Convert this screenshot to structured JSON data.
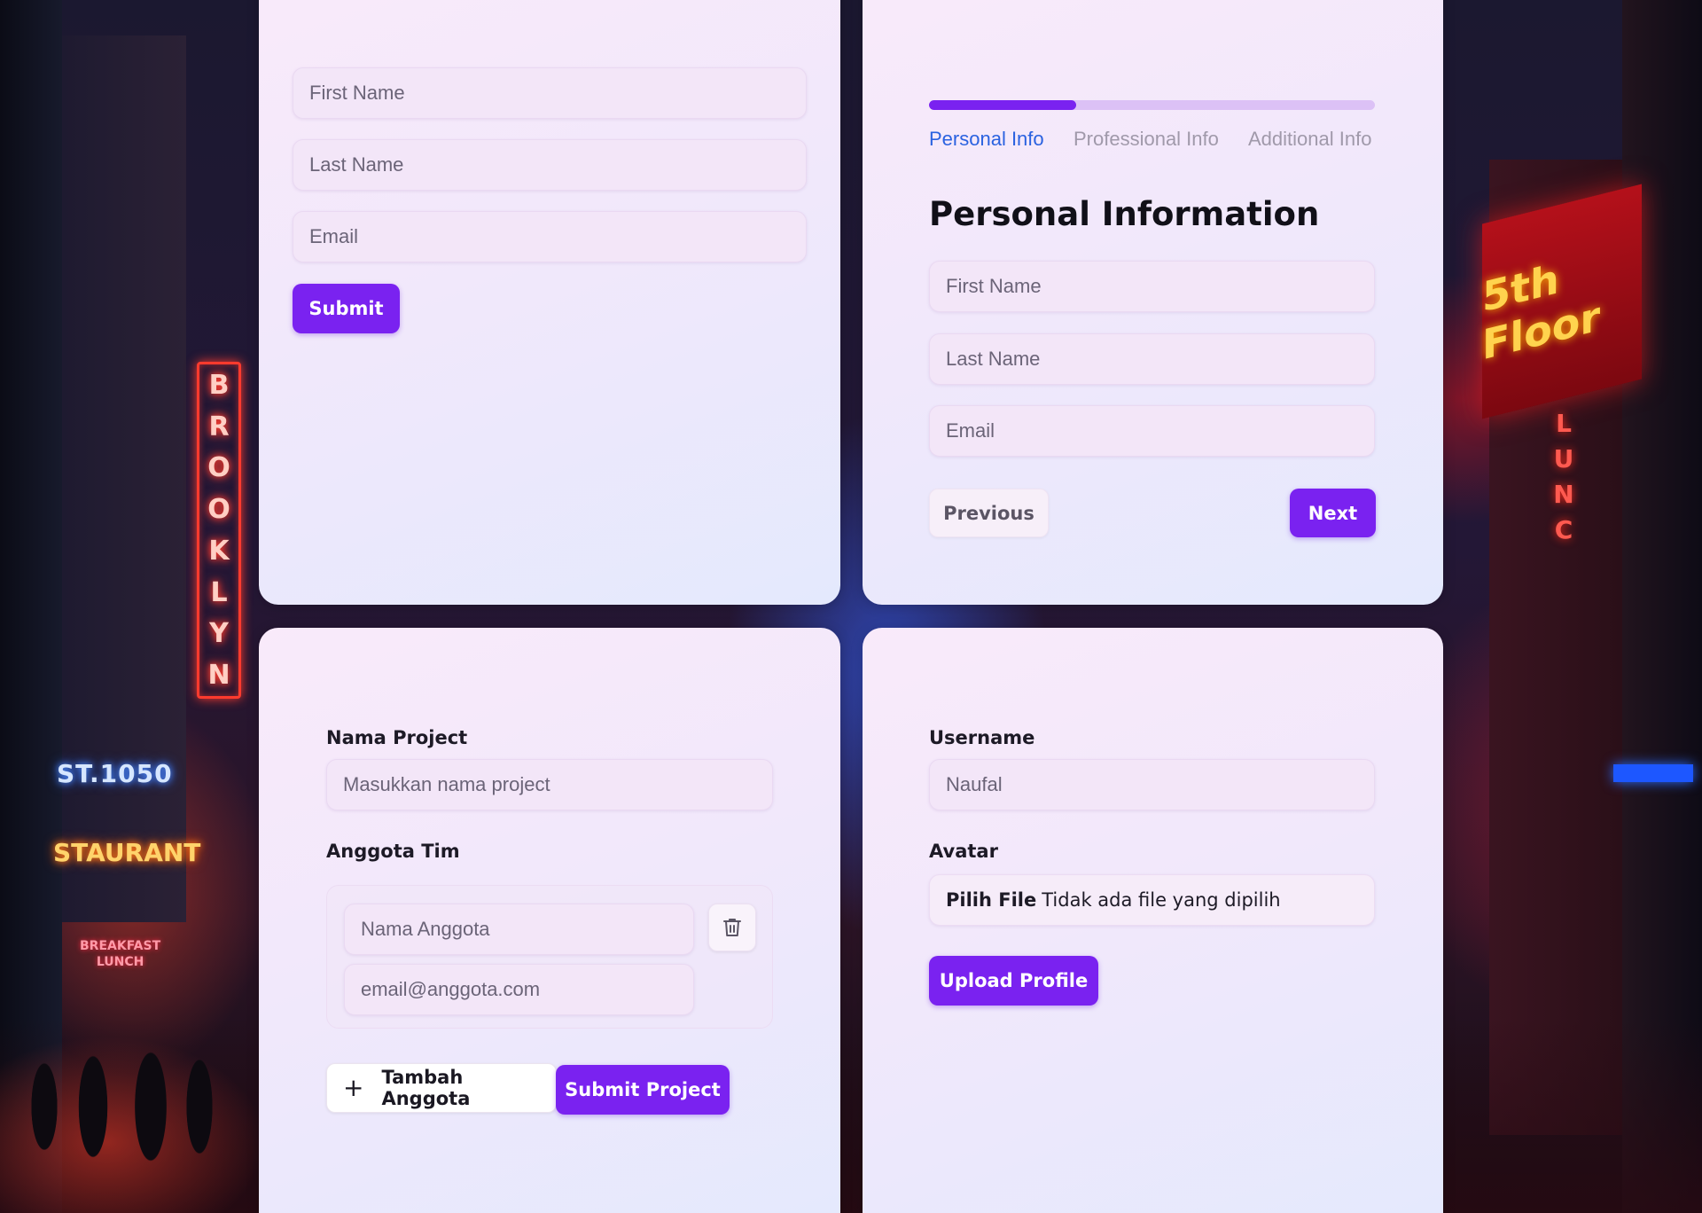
{
  "background": {
    "signs": {
      "brooklyn": [
        "B",
        "R",
        "O",
        "O",
        "K",
        "L",
        "Y",
        "N"
      ],
      "street": "ST.1050",
      "restaurant": "STAURANT",
      "breakfast_line1": "BREAKFAST",
      "breakfast_line2": "LUNCH",
      "floor": "5th Floor",
      "lunch_letters": [
        "L",
        "U",
        "N",
        "C"
      ]
    }
  },
  "simple_form": {
    "first_name_placeholder": "First Name",
    "last_name_placeholder": "Last Name",
    "email_placeholder": "Email",
    "submit_label": "Submit"
  },
  "stepper_form": {
    "progress_fraction": 0.33,
    "steps": [
      "Personal Info",
      "Professional Info",
      "Additional Info"
    ],
    "active_step": 0,
    "title": "Personal Information",
    "first_name_placeholder": "First Name",
    "last_name_placeholder": "Last Name",
    "email_placeholder": "Email",
    "previous_label": "Previous",
    "next_label": "Next"
  },
  "project_form": {
    "project_name_label": "Nama Project",
    "project_name_placeholder": "Masukkan nama project",
    "team_label": "Anggota Tim",
    "member_name_placeholder": "Nama Anggota",
    "member_email_placeholder": "email@anggota.com",
    "add_member_label": "Tambah Anggota",
    "submit_label": "Submit Project"
  },
  "profile_form": {
    "username_label": "Username",
    "username_value": "Naufal",
    "avatar_label": "Avatar",
    "choose_file_label": "Pilih File",
    "no_file_text": "Tidak ada file yang dipilih",
    "upload_label": "Upload Profile"
  },
  "colors": {
    "accent": "#7a22f0",
    "active_step": "#2a62e0",
    "card_bg": "#f3e9fa"
  },
  "icons": {
    "delete": "trash-icon",
    "add": "plus-icon"
  }
}
